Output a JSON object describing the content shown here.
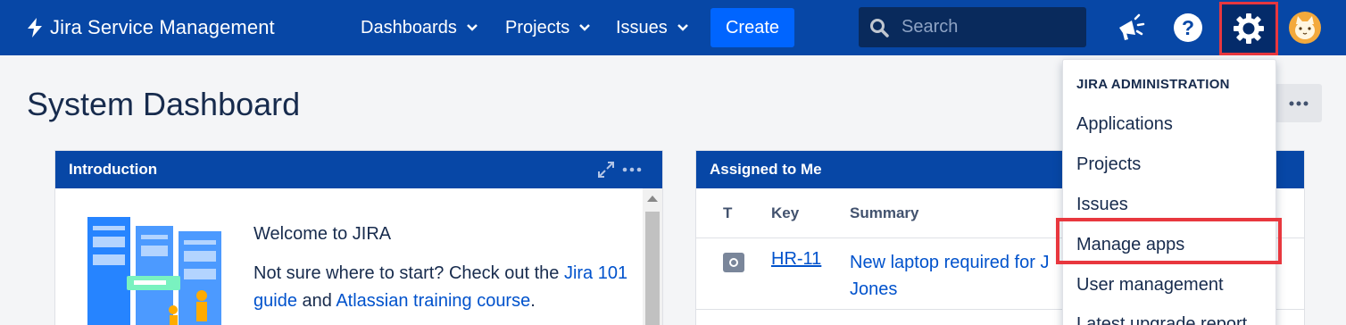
{
  "nav": {
    "logo": "Jira Service Management",
    "dashboards": "Dashboards",
    "projects": "Projects",
    "issues": "Issues",
    "create": "Create",
    "search_placeholder": "Search"
  },
  "page": {
    "title": "System Dashboard"
  },
  "intro_gadget": {
    "title": "Introduction",
    "welcome": "Welcome to JIRA",
    "not_sure_prefix": "Not sure where to start? Check out the ",
    "guide_link": "Jira 101 guide",
    "and_text": " and ",
    "training_link": "Atlassian training course",
    "period": "."
  },
  "assigned_gadget": {
    "title": "Assigned to Me",
    "columns": [
      "T",
      "Key",
      "Summary"
    ],
    "rows": [
      {
        "key": "HR-11",
        "summary": "New laptop required for J Jones"
      }
    ]
  },
  "admin_menu": {
    "heading": "JIRA ADMINISTRATION",
    "items": [
      "Applications",
      "Projects",
      "Issues",
      "Manage apps",
      "User management",
      "Latest upgrade report"
    ]
  },
  "colors": {
    "nav_bg": "#0747a6",
    "create_btn": "#0065ff",
    "highlight": "#e8373e",
    "link": "#0052cc"
  }
}
